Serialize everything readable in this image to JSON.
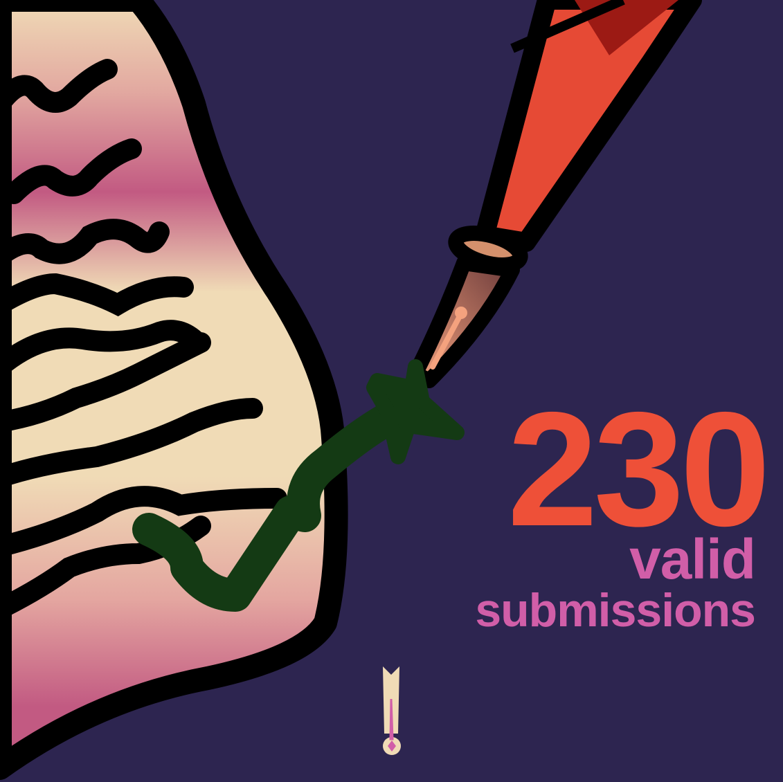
{
  "stat": {
    "number": "230",
    "label_line1": "valid",
    "label_line2": "submissions"
  },
  "colors": {
    "background": "#2d2550",
    "number": "#ee5038",
    "label": "#d15ea8",
    "paper": "#f0dbb6",
    "paper_shade": "#c25a82",
    "check": "#143a14"
  },
  "icons": [
    "paper-scroll-icon",
    "quill-brush-icon",
    "checkmark-icon",
    "logo-exclamation-icon"
  ]
}
